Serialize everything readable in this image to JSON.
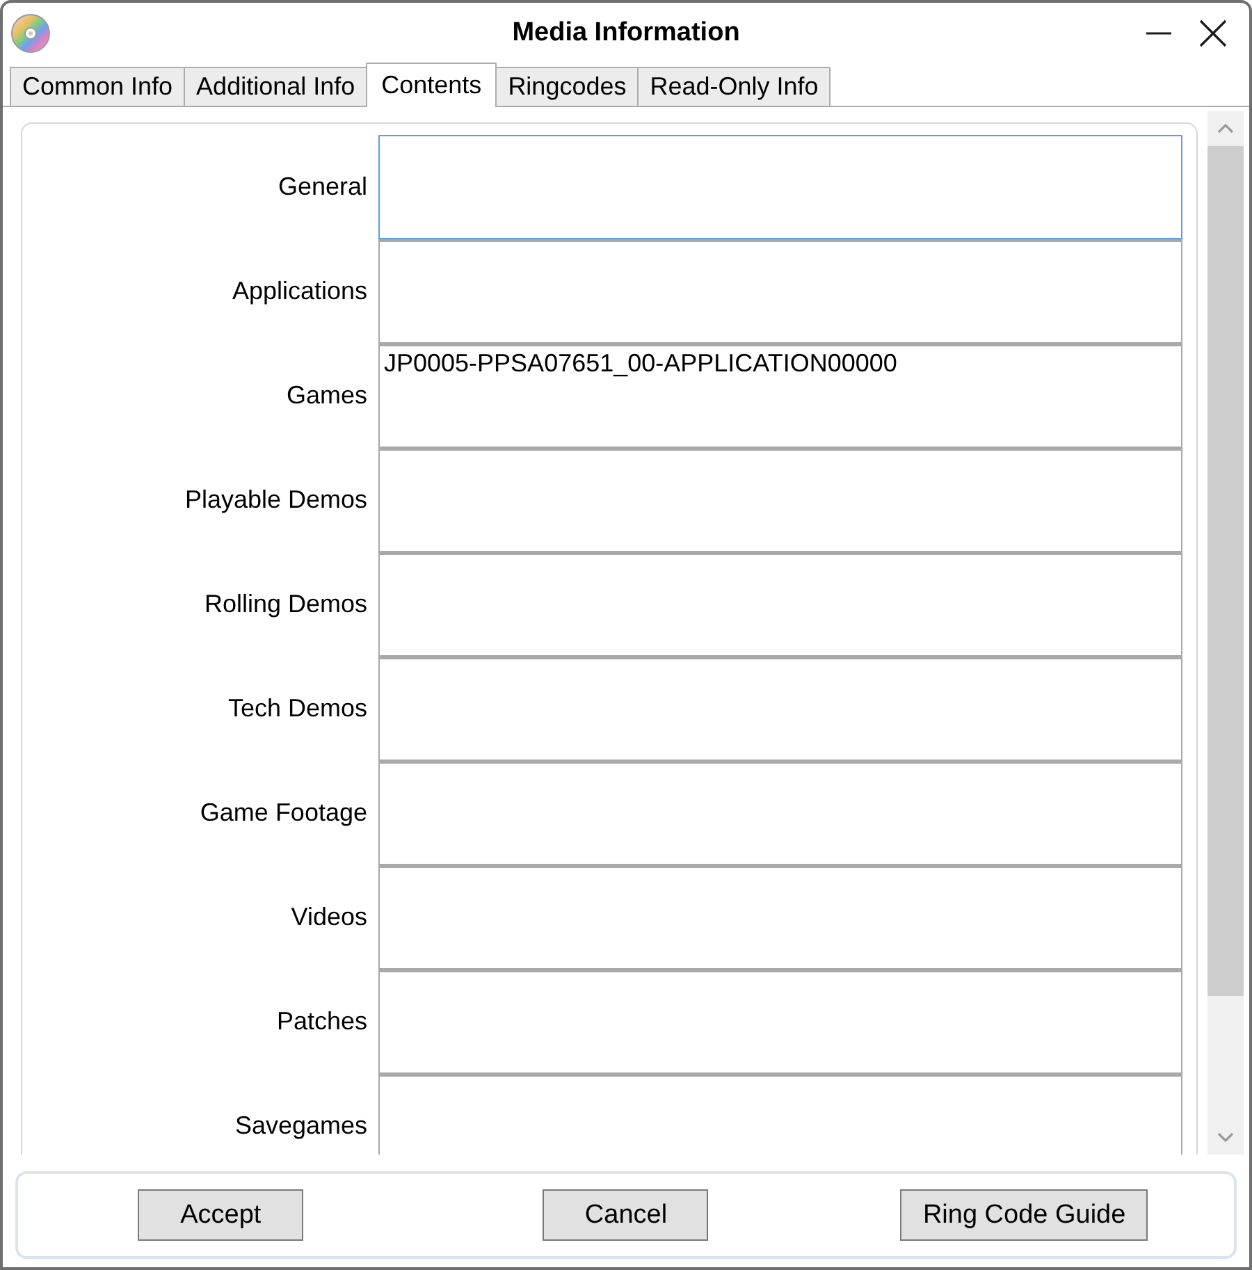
{
  "window": {
    "title": "Media Information"
  },
  "tabs": [
    {
      "label": "Common Info",
      "selected": false
    },
    {
      "label": "Additional Info",
      "selected": false
    },
    {
      "label": "Contents",
      "selected": true
    },
    {
      "label": "Ringcodes",
      "selected": false
    },
    {
      "label": "Read-Only Info",
      "selected": false
    }
  ],
  "fields": [
    {
      "label": "General",
      "focused": true
    },
    {
      "label": "Applications",
      "focused": false
    },
    {
      "label": "Games",
      "focused": false,
      "value": "JP0005-PPSA07651_00-APPLICATION00000"
    },
    {
      "label": "Playable Demos",
      "focused": false
    },
    {
      "label": "Rolling Demos",
      "focused": false
    },
    {
      "label": "Tech Demos",
      "focused": false
    },
    {
      "label": "Game Footage",
      "focused": false
    },
    {
      "label": "Videos",
      "focused": false
    },
    {
      "label": "Patches",
      "focused": false
    },
    {
      "label": "Savegames",
      "focused": false
    }
  ],
  "buttons": [
    "Accept",
    "Cancel",
    "Ring Code Guide"
  ]
}
